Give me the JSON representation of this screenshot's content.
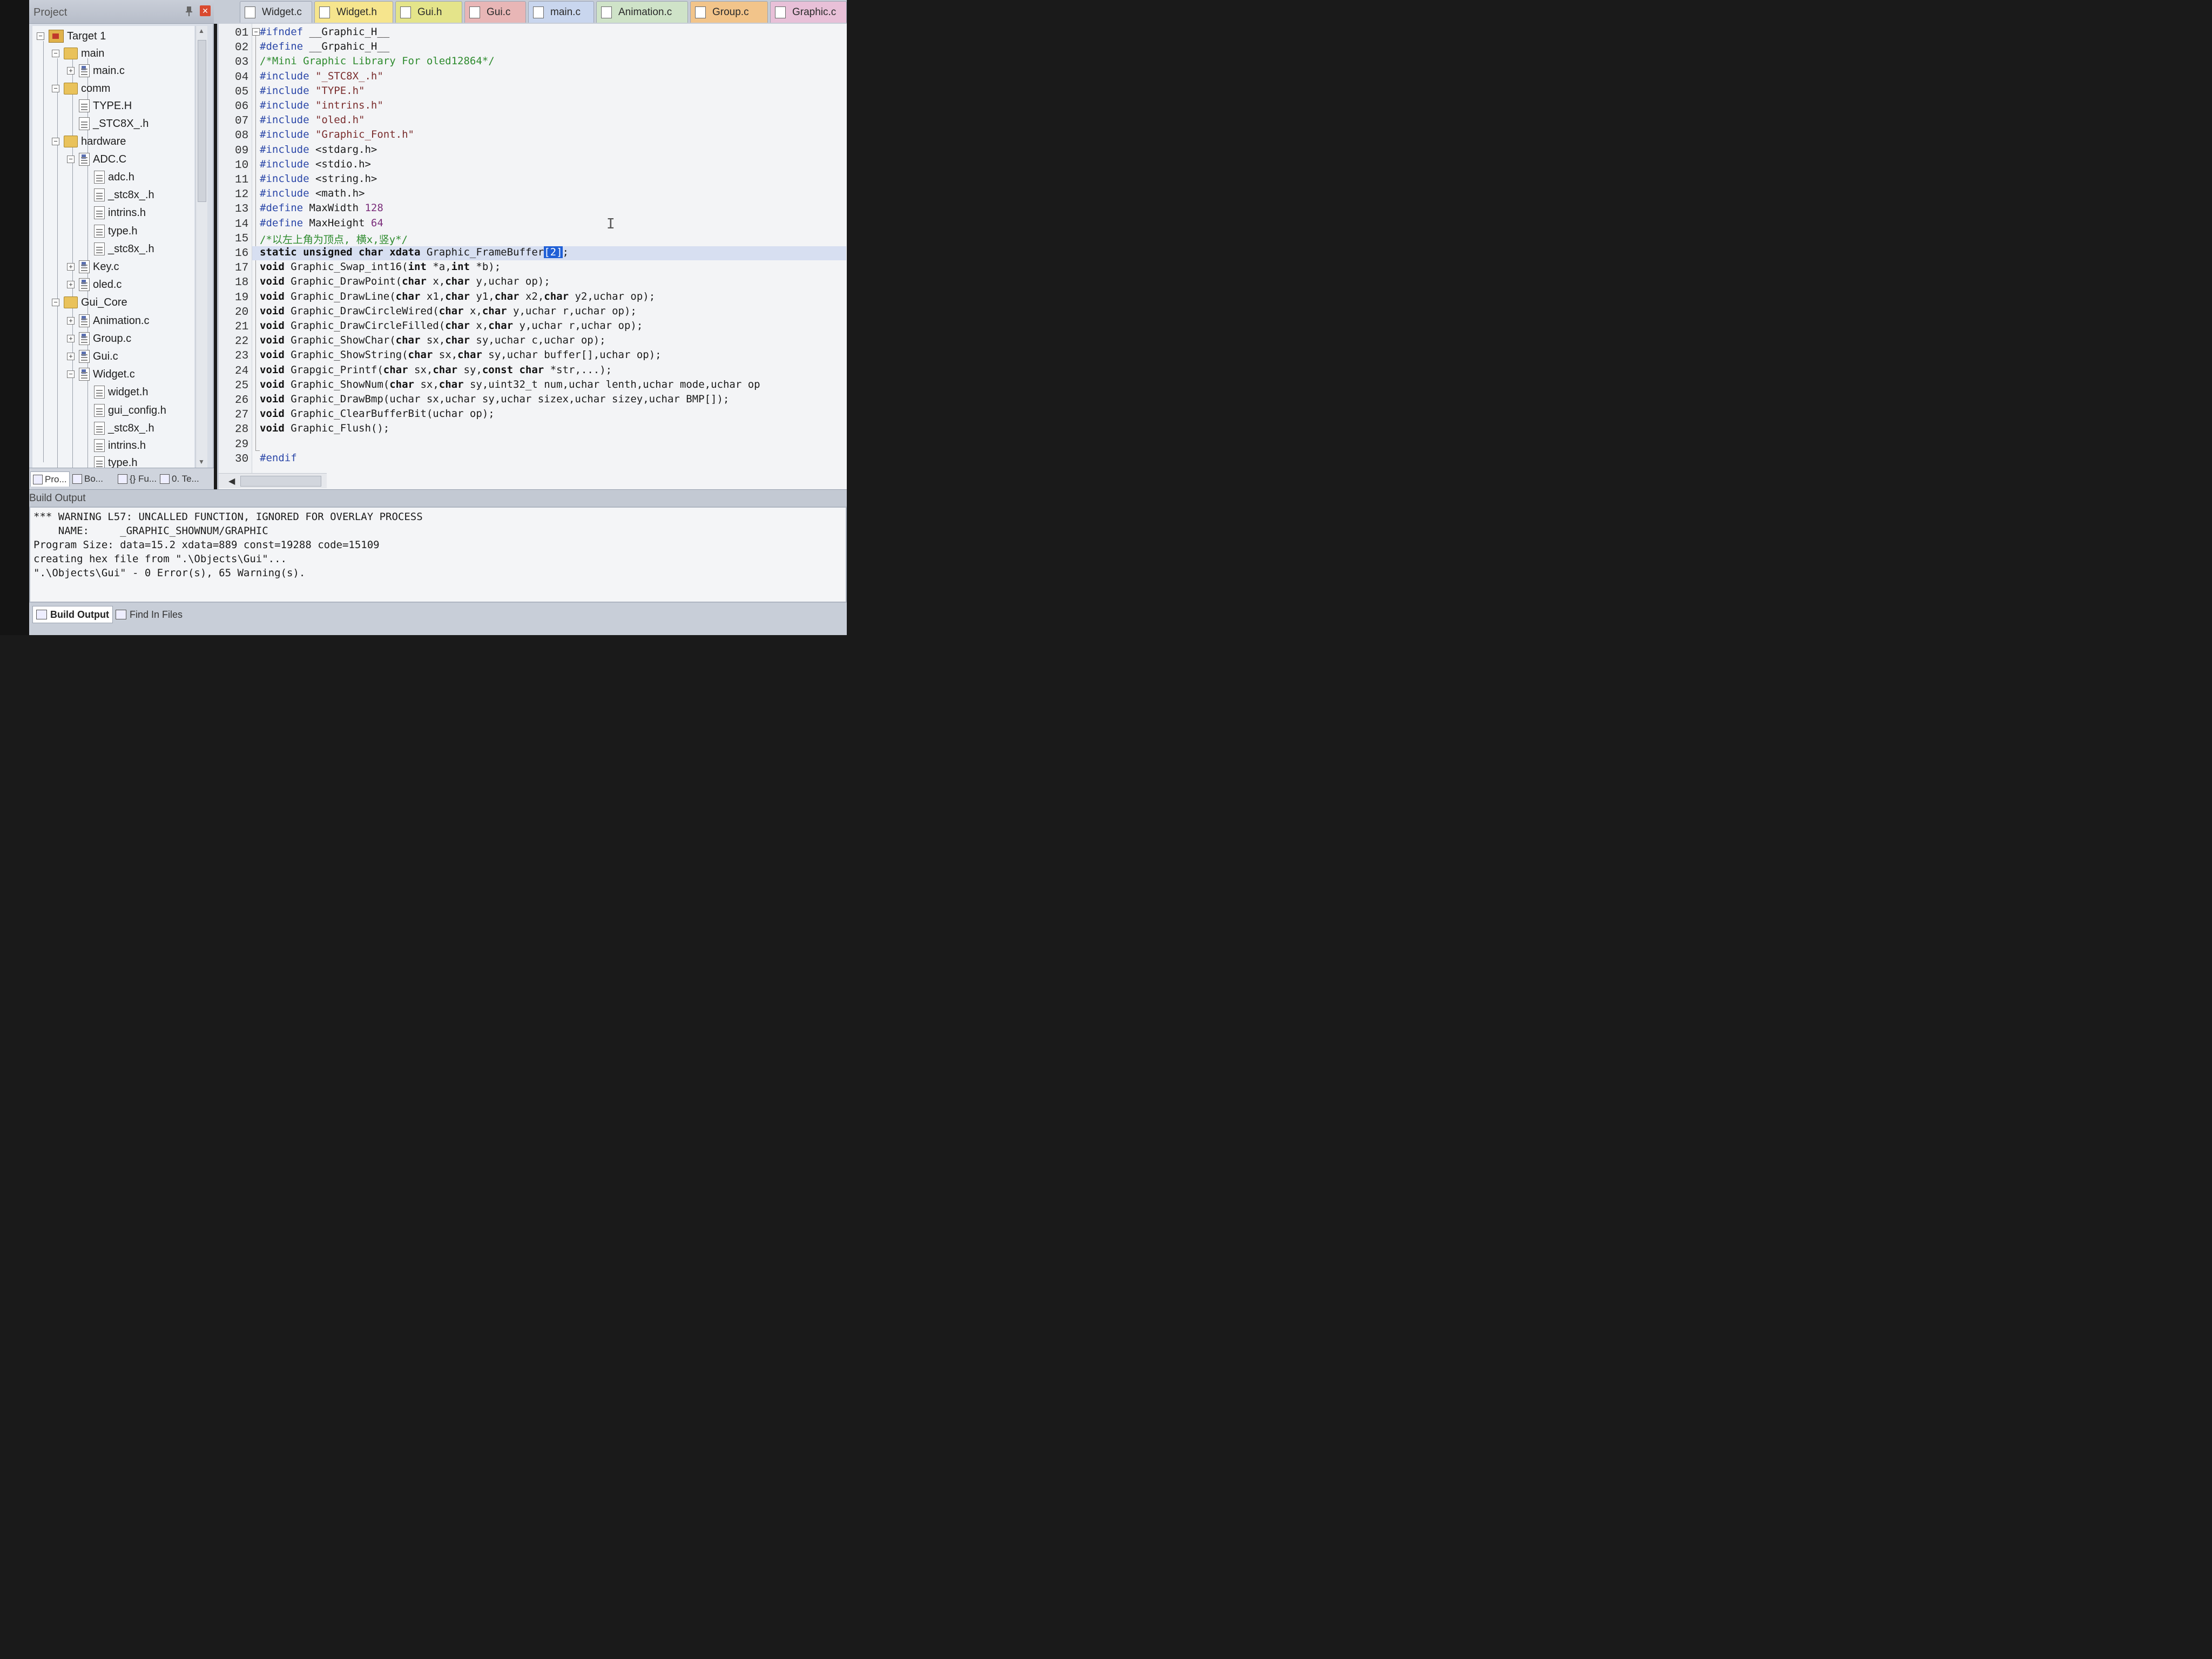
{
  "project": {
    "title": "Project",
    "tree": [
      {
        "label": "Target 1",
        "type": "target",
        "expander": "−"
      },
      {
        "label": "main",
        "type": "folder",
        "expander": "−"
      },
      {
        "label": "main.c",
        "type": "src",
        "expander": "+"
      },
      {
        "label": "comm",
        "type": "folder",
        "expander": "−"
      },
      {
        "label": "TYPE.H",
        "type": "file",
        "expander": ""
      },
      {
        "label": "_STC8X_.h",
        "type": "file",
        "expander": ""
      },
      {
        "label": "hardware",
        "type": "folder",
        "expander": "−"
      },
      {
        "label": "ADC.C",
        "type": "src",
        "expander": "−"
      },
      {
        "label": "adc.h",
        "type": "file",
        "expander": ""
      },
      {
        "label": "_stc8x_.h",
        "type": "file",
        "expander": ""
      },
      {
        "label": "intrins.h",
        "type": "file",
        "expander": ""
      },
      {
        "label": "type.h",
        "type": "file",
        "expander": ""
      },
      {
        "label": "_stc8x_.h",
        "type": "file",
        "expander": ""
      },
      {
        "label": "Key.c",
        "type": "src",
        "expander": "+"
      },
      {
        "label": "oled.c",
        "type": "src",
        "expander": "+"
      },
      {
        "label": "Gui_Core",
        "type": "folder",
        "expander": "−"
      },
      {
        "label": "Animation.c",
        "type": "src",
        "expander": "+"
      },
      {
        "label": "Group.c",
        "type": "src",
        "expander": "+"
      },
      {
        "label": "Gui.c",
        "type": "src",
        "expander": "+"
      },
      {
        "label": "Widget.c",
        "type": "src",
        "expander": "−"
      },
      {
        "label": "widget.h",
        "type": "file",
        "expander": ""
      },
      {
        "label": "gui_config.h",
        "type": "file",
        "expander": ""
      },
      {
        "label": "_stc8x_.h",
        "type": "file",
        "expander": ""
      },
      {
        "label": "intrins.h",
        "type": "file",
        "expander": ""
      },
      {
        "label": "type.h",
        "type": "file",
        "expander": ""
      }
    ],
    "bottom_tabs": [
      "Pro...",
      "Bo...",
      "{} Fu...",
      "0. Te..."
    ]
  },
  "editor": {
    "tabs": [
      "Widget.c",
      "Widget.h",
      "Gui.h",
      "Gui.c",
      "main.c",
      "Animation.c",
      "Group.c",
      "Graphic.c"
    ],
    "active_tab": "Widget.h",
    "line_numbers": [
      "01",
      "02",
      "03",
      "04",
      "05",
      "06",
      "07",
      "08",
      "09",
      "10",
      "11",
      "12",
      "13",
      "14",
      "15",
      "16",
      "17",
      "18",
      "19",
      "20",
      "21",
      "22",
      "23",
      "24",
      "25",
      "26",
      "27",
      "28",
      "29",
      "30"
    ],
    "lines": [
      [
        {
          "t": "#ifndef",
          "c": "kw-pre"
        },
        {
          "t": " __Graphic_H__",
          "c": ""
        }
      ],
      [
        {
          "t": "#define",
          "c": "kw-pre"
        },
        {
          "t": " __Grpahic_H__",
          "c": ""
        }
      ],
      [
        {
          "t": "/*Mini Graphic Library For oled12864*/",
          "c": "cmt"
        }
      ],
      [
        {
          "t": "#include",
          "c": "kw-pre"
        },
        {
          "t": " \"_STC8X_.h\"",
          "c": "str"
        }
      ],
      [
        {
          "t": "#include",
          "c": "kw-pre"
        },
        {
          "t": " \"TYPE.h\"",
          "c": "str"
        }
      ],
      [
        {
          "t": "#include",
          "c": "kw-pre"
        },
        {
          "t": " \"intrins.h\"",
          "c": "str"
        }
      ],
      [
        {
          "t": "#include",
          "c": "kw-pre"
        },
        {
          "t": " \"oled.h\"",
          "c": "str"
        }
      ],
      [
        {
          "t": "#include",
          "c": "kw-pre"
        },
        {
          "t": " \"Graphic_Font.h\"",
          "c": "str"
        }
      ],
      [
        {
          "t": "#include",
          "c": "kw-pre"
        },
        {
          "t": " <stdarg.h>",
          "c": ""
        }
      ],
      [
        {
          "t": "#include",
          "c": "kw-pre"
        },
        {
          "t": " <stdio.h>",
          "c": ""
        }
      ],
      [
        {
          "t": "#include",
          "c": "kw-pre"
        },
        {
          "t": " <string.h>",
          "c": ""
        }
      ],
      [
        {
          "t": "#include",
          "c": "kw-pre"
        },
        {
          "t": " <math.h>",
          "c": ""
        }
      ],
      [
        {
          "t": "#define",
          "c": "kw-pre"
        },
        {
          "t": " MaxWidth ",
          "c": ""
        },
        {
          "t": "128",
          "c": "num"
        }
      ],
      [
        {
          "t": "#define",
          "c": "kw-pre"
        },
        {
          "t": " MaxHeight ",
          "c": ""
        },
        {
          "t": "64",
          "c": "num"
        }
      ],
      [
        {
          "t": "/*以左上角为顶点, 横x,竖y*/",
          "c": "cmt"
        }
      ],
      [
        {
          "t": "static unsigned char xdata",
          "c": "kw"
        },
        {
          "t": " Graphic_FrameBuffer",
          "c": ""
        },
        {
          "t": "[2]",
          "c": "sel"
        },
        {
          "t": ";",
          "c": ""
        }
      ],
      [
        {
          "t": "void",
          "c": "kw"
        },
        {
          "t": " Graphic_Swap_int16(",
          "c": ""
        },
        {
          "t": "int",
          "c": "kw"
        },
        {
          "t": " *a,",
          "c": ""
        },
        {
          "t": "int",
          "c": "kw"
        },
        {
          "t": " *b);",
          "c": ""
        }
      ],
      [
        {
          "t": "void",
          "c": "kw"
        },
        {
          "t": " Graphic_DrawPoint(",
          "c": ""
        },
        {
          "t": "char",
          "c": "kw"
        },
        {
          "t": " x,",
          "c": ""
        },
        {
          "t": "char",
          "c": "kw"
        },
        {
          "t": " y,uchar op);",
          "c": ""
        }
      ],
      [
        {
          "t": "void",
          "c": "kw"
        },
        {
          "t": " Graphic_DrawLine(",
          "c": ""
        },
        {
          "t": "char",
          "c": "kw"
        },
        {
          "t": " x1,",
          "c": ""
        },
        {
          "t": "char",
          "c": "kw"
        },
        {
          "t": " y1,",
          "c": ""
        },
        {
          "t": "char",
          "c": "kw"
        },
        {
          "t": " x2,",
          "c": ""
        },
        {
          "t": "char",
          "c": "kw"
        },
        {
          "t": " y2,uchar op);",
          "c": ""
        }
      ],
      [
        {
          "t": "void",
          "c": "kw"
        },
        {
          "t": " Graphic_DrawCircleWired(",
          "c": ""
        },
        {
          "t": "char",
          "c": "kw"
        },
        {
          "t": " x,",
          "c": ""
        },
        {
          "t": "char",
          "c": "kw"
        },
        {
          "t": " y,uchar r,uchar op);",
          "c": ""
        }
      ],
      [
        {
          "t": "void",
          "c": "kw"
        },
        {
          "t": " Graphic_DrawCircleFilled(",
          "c": ""
        },
        {
          "t": "char",
          "c": "kw"
        },
        {
          "t": " x,",
          "c": ""
        },
        {
          "t": "char",
          "c": "kw"
        },
        {
          "t": " y,uchar r,uchar op);",
          "c": ""
        }
      ],
      [
        {
          "t": "void",
          "c": "kw"
        },
        {
          "t": " Graphic_ShowChar(",
          "c": ""
        },
        {
          "t": "char",
          "c": "kw"
        },
        {
          "t": " sx,",
          "c": ""
        },
        {
          "t": "char",
          "c": "kw"
        },
        {
          "t": " sy,uchar c,uchar op);",
          "c": ""
        }
      ],
      [
        {
          "t": "void",
          "c": "kw"
        },
        {
          "t": " Graphic_ShowString(",
          "c": ""
        },
        {
          "t": "char",
          "c": "kw"
        },
        {
          "t": " sx,",
          "c": ""
        },
        {
          "t": "char",
          "c": "kw"
        },
        {
          "t": " sy,uchar buffer[],uchar op);",
          "c": ""
        }
      ],
      [
        {
          "t": "void",
          "c": "kw"
        },
        {
          "t": " Grapgic_Printf(",
          "c": ""
        },
        {
          "t": "char",
          "c": "kw"
        },
        {
          "t": " sx,",
          "c": ""
        },
        {
          "t": "char",
          "c": "kw"
        },
        {
          "t": " sy,",
          "c": ""
        },
        {
          "t": "const char",
          "c": "kw"
        },
        {
          "t": " *str,...);",
          "c": ""
        }
      ],
      [
        {
          "t": "void",
          "c": "kw"
        },
        {
          "t": " Graphic_ShowNum(",
          "c": ""
        },
        {
          "t": "char",
          "c": "kw"
        },
        {
          "t": " sx,",
          "c": ""
        },
        {
          "t": "char",
          "c": "kw"
        },
        {
          "t": " sy,uint32_t num,uchar lenth,uchar mode,uchar op",
          "c": ""
        }
      ],
      [
        {
          "t": "void",
          "c": "kw"
        },
        {
          "t": " Graphic_DrawBmp(uchar sx,uchar sy,uchar sizex,uchar sizey,uchar BMP[]);",
          "c": ""
        }
      ],
      [
        {
          "t": "void",
          "c": "kw"
        },
        {
          "t": " Graphic_ClearBufferBit(uchar op);",
          "c": ""
        }
      ],
      [
        {
          "t": "void",
          "c": "kw"
        },
        {
          "t": " Graphic_Flush();",
          "c": ""
        }
      ],
      [],
      [
        {
          "t": "#endif",
          "c": "kw-pre"
        }
      ]
    ]
  },
  "build": {
    "title": "Build Output",
    "lines": [
      "*** WARNING L57: UNCALLED FUNCTION, IGNORED FOR OVERLAY PROCESS",
      "    NAME:     _GRAPHIC_SHOWNUM/GRAPHIC",
      "Program Size: data=15.2 xdata=889 const=19288 code=15109",
      "creating hex file from \".\\Objects\\Gui\"...",
      "\".\\Objects\\Gui\" - 0 Error(s), 65 Warning(s)."
    ],
    "tabs": [
      "Build Output",
      "Find In Files"
    ]
  },
  "colors": {
    "active_tab": "#f6e58d",
    "selection": "#1f5fd6",
    "current_line": "#d7dff1"
  }
}
